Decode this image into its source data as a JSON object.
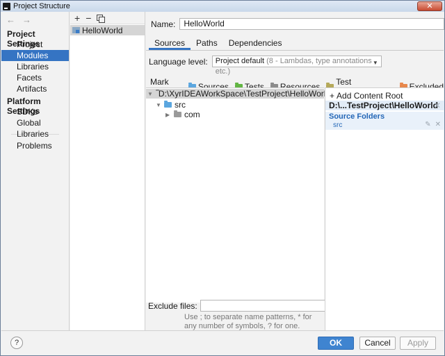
{
  "window": {
    "title": "Project Structure",
    "close_label": "✕"
  },
  "nav": {
    "project_settings_label": "Project Settings",
    "project_items": [
      "Project",
      "Modules",
      "Libraries",
      "Facets",
      "Artifacts"
    ],
    "selected": "Modules",
    "platform_settings_label": "Platform Settings",
    "platform_items": [
      "SDKs",
      "Global Libraries"
    ],
    "problems_label": "Problems"
  },
  "modules": {
    "items": [
      "HelloWorld"
    ]
  },
  "module": {
    "name_label": "Name:",
    "name_value": "HelloWorld",
    "tabs": [
      "Sources",
      "Paths",
      "Dependencies"
    ],
    "active_tab": "Sources",
    "language_level_label": "Language level:",
    "language_level_value": "Project default",
    "language_level_detail": "(8 - Lambdas, type annotations etc.)",
    "mark_as_label": "Mark as:",
    "mark_as_items": [
      {
        "label": "Sources",
        "color": "#5ba6df"
      },
      {
        "label": "Tests",
        "color": "#62b543"
      },
      {
        "label": "Resources",
        "color": "#8c8c8c"
      },
      {
        "label": "Test Resources",
        "color": "#b5a95a"
      },
      {
        "label": "Excluded",
        "color": "#e8884d"
      }
    ],
    "tree_root": "D:\\XyrIDEAWorkSpace\\TestProject\\HelloWorld",
    "tree_src": "src",
    "tree_com": "com",
    "exclude_label": "Exclude files:",
    "exclude_value": "",
    "exclude_hint": "Use ; to separate name patterns, * for any number of symbols, ? for one."
  },
  "content_root": {
    "add_label": "Add Content Root",
    "path": "D:\\...TestProject\\HelloWorld",
    "source_folders_label": "Source Folders",
    "source_folder": "src"
  },
  "footer": {
    "help": "?",
    "ok": "OK",
    "cancel": "Cancel",
    "apply": "Apply"
  }
}
